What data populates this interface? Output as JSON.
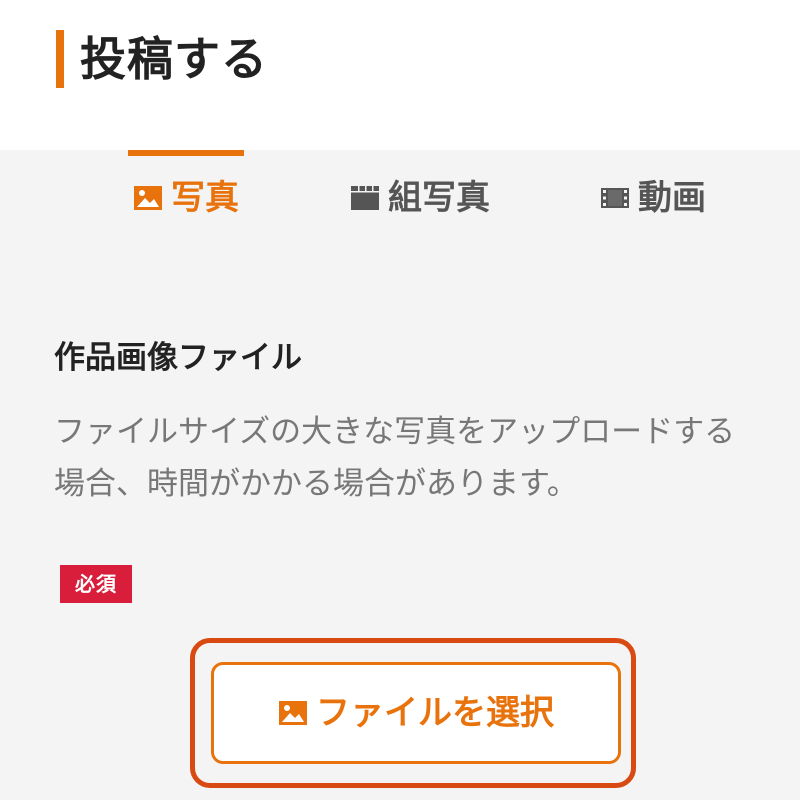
{
  "header": {
    "title": "投稿する"
  },
  "tabs": [
    {
      "label": "写真",
      "icon": "image-icon",
      "active": true
    },
    {
      "label": "組写真",
      "icon": "grid-photos-icon",
      "active": false
    },
    {
      "label": "動画",
      "icon": "film-icon",
      "active": false
    }
  ],
  "form": {
    "field_label": "作品画像ファイル",
    "description": "ファイルサイズの大きな写真をアップロードする場合、時間がかかる場合があります。",
    "required_badge": "必須",
    "file_button_label": "ファイルを選択",
    "file_button_icon": "image-icon"
  },
  "colors": {
    "accent": "#e8720c",
    "required": "#d81e3a",
    "focus": "#d94a13",
    "panel_background": "#f4f4f4",
    "inactive_tab": "#555555",
    "description_text": "#777777"
  }
}
